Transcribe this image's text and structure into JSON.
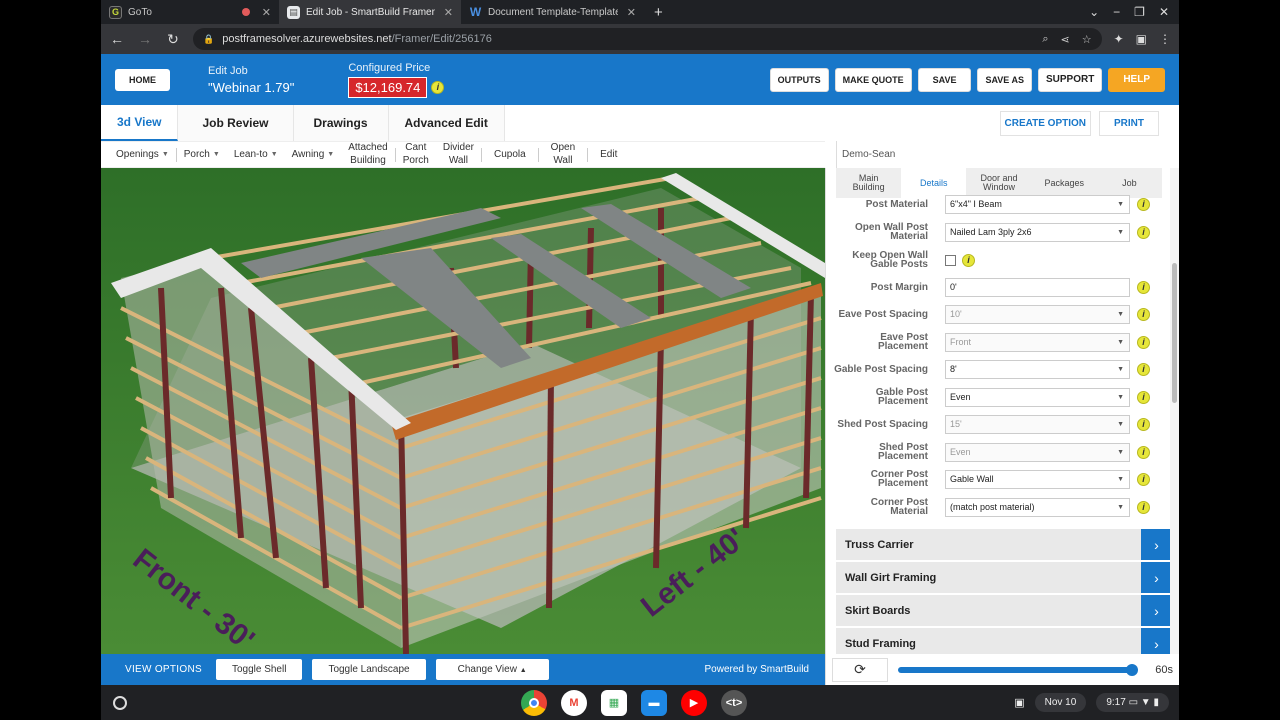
{
  "browser": {
    "tabs": [
      {
        "label": "GoTo",
        "icon": "goto-icon"
      },
      {
        "label": "Edit Job - SmartBuild Framer",
        "icon": "page-icon"
      },
      {
        "label": "Document Template-Template (",
        "icon": "word-icon"
      }
    ],
    "url_host": "postframesolver.azurewebsites.net",
    "url_path": "/Framer/Edit/256176"
  },
  "header": {
    "home_label": "HOME",
    "job_label": "Edit Job",
    "job_name": "\"Webinar 1.79\"",
    "price_label": "Configured Price",
    "price": "$12,169.74",
    "buttons": [
      "OUTPUTS",
      "MAKE QUOTE",
      "SAVE",
      "SAVE AS",
      "SUPPORT",
      "HELP"
    ]
  },
  "main_tabs": [
    {
      "label": "3d View",
      "active": true
    },
    {
      "label": "Job Review",
      "active": false
    },
    {
      "label": "Drawings",
      "active": false
    },
    {
      "label": "Advanced Edit",
      "active": false
    }
  ],
  "tab_actions": [
    "CREATE OPTION",
    "PRINT"
  ],
  "toolbar": {
    "openings": "Openings",
    "porch": "Porch",
    "leanto": "Lean-to",
    "awning": "Awning",
    "attached_1": "Attached",
    "attached_2": "Building",
    "cant_1": "Cant",
    "cant_2": "Porch",
    "divider_1": "Divider",
    "divider_2": "Wall",
    "cupola": "Cupola",
    "open_1": "Open",
    "open_2": "Wall",
    "edit": "Edit"
  },
  "viewer_user": "Demo-Sean",
  "viewport": {
    "front_label": "Front - 30'",
    "left_label": "Left - 40'"
  },
  "panel": {
    "tabs": [
      {
        "l1": "Main",
        "l2": "Building"
      },
      {
        "l1": "Details",
        "l2": ""
      },
      {
        "l1": "Door and",
        "l2": "Window"
      },
      {
        "l1": "Packages",
        "l2": ""
      },
      {
        "l1": "Job",
        "l2": ""
      }
    ],
    "fields": [
      {
        "l1": "Post Material",
        "l2": "",
        "value": "6\"x4\" I Beam",
        "disabled": false
      },
      {
        "l1": "Open Wall Post",
        "l2": "Material",
        "value": "Nailed Lam 3ply 2x6",
        "disabled": false
      },
      {
        "l1": "Keep Open Wall",
        "l2": "Gable Posts",
        "value": "",
        "checkbox": true
      },
      {
        "l1": "Post Margin",
        "l2": "",
        "value": "0'",
        "disabled": false
      },
      {
        "l1": "Eave Post Spacing",
        "l2": "",
        "value": "10'",
        "disabled": true
      },
      {
        "l1": "Eave Post",
        "l2": "Placement",
        "value": "Front",
        "disabled": true
      },
      {
        "l1": "Gable Post Spacing",
        "l2": "",
        "value": "8'",
        "disabled": false
      },
      {
        "l1": "Gable Post",
        "l2": "Placement",
        "value": "Even",
        "disabled": false
      },
      {
        "l1": "Shed Post Spacing",
        "l2": "",
        "value": "15'",
        "disabled": true
      },
      {
        "l1": "Shed Post",
        "l2": "Placement",
        "value": "Even",
        "disabled": true
      },
      {
        "l1": "Corner Post",
        "l2": "Placement",
        "value": "Gable Wall",
        "disabled": false
      },
      {
        "l1": "Corner Post",
        "l2": "Material",
        "value": "(match post material)",
        "disabled": false
      }
    ],
    "accordions": [
      "Truss Carrier",
      "Wall Girt Framing",
      "Skirt Boards",
      "Stud Framing"
    ]
  },
  "bottom_bar": {
    "view_options": "VIEW OPTIONS",
    "toggle_shell": "Toggle Shell",
    "toggle_landscape": "Toggle Landscape",
    "change_view": "Change View",
    "powered": "Powered by SmartBuild"
  },
  "video": {
    "seconds": "60s",
    "progress": 1.0
  },
  "taskbar": {
    "date": "Nov 10",
    "time": "9:17"
  },
  "colors": {
    "accent": "#1877c9",
    "price_bg": "#d6262b",
    "help": "#f5a623",
    "grass": "#3a7a2c"
  }
}
